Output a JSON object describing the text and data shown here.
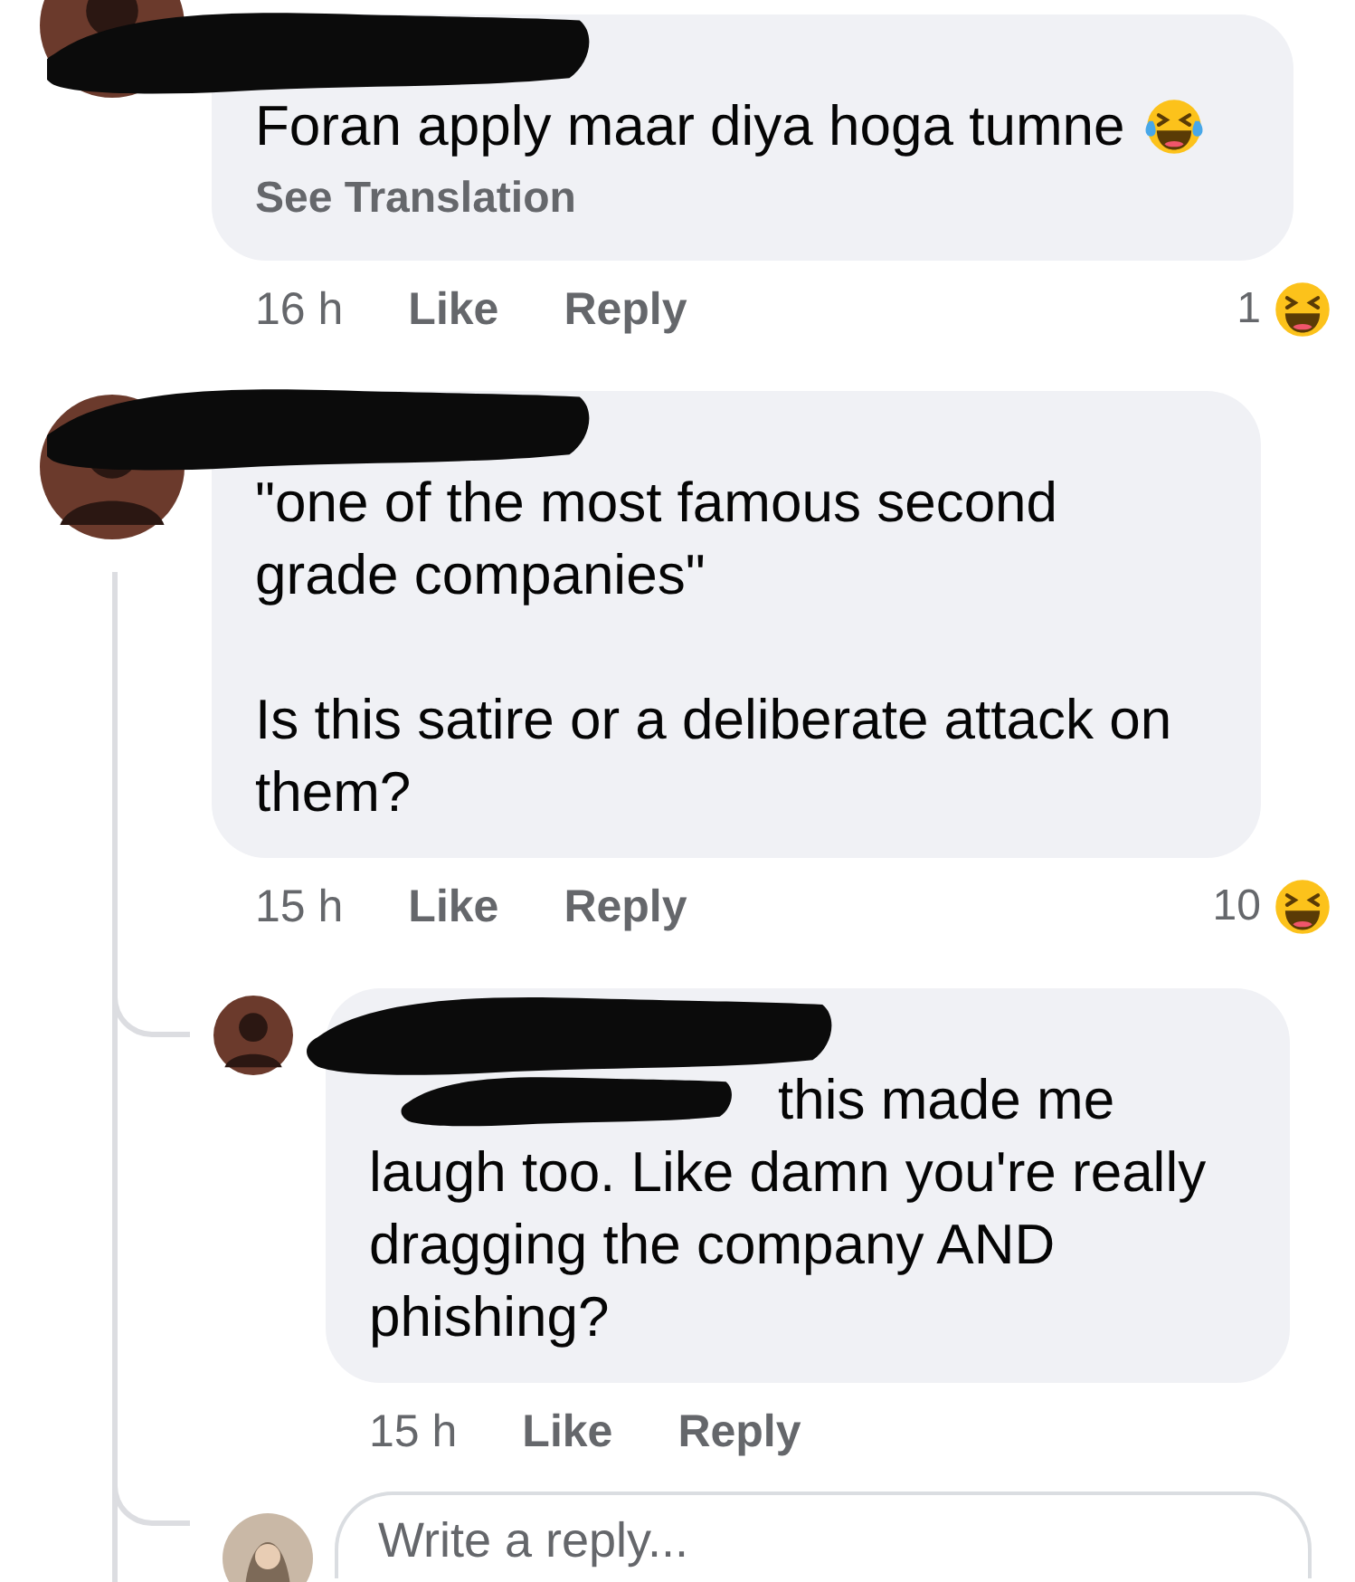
{
  "comments": [
    {
      "author": {
        "redacted": true
      },
      "paragraphs": [
        "Foran apply maar diya hoga tumne"
      ],
      "trailing_icon": {
        "kind": "tears-of-joy"
      },
      "see_translation": "See Translation",
      "time": "16 h",
      "actions": [
        "Like",
        "Reply"
      ],
      "reactions": {
        "count": "1",
        "kind": "haha"
      }
    },
    {
      "author": {
        "redacted": true
      },
      "paragraphs": [
        "\"one of the most famous second grade companies\"",
        "Is this satire or a deliberate attack on them?"
      ],
      "time": "15 h",
      "actions": [
        "Like",
        "Reply"
      ],
      "reactions": {
        "count": "10",
        "kind": "haha"
      },
      "replies": [
        {
          "author": {
            "redacted": true
          },
          "mention": {
            "redacted": true
          },
          "text": "this made me laugh too. Like damn you're really dragging the company AND phishing?",
          "time": "15 h",
          "actions": [
            "Like",
            "Reply"
          ]
        }
      ],
      "reply_box": {
        "placeholder": "Write a reply..."
      }
    }
  ]
}
